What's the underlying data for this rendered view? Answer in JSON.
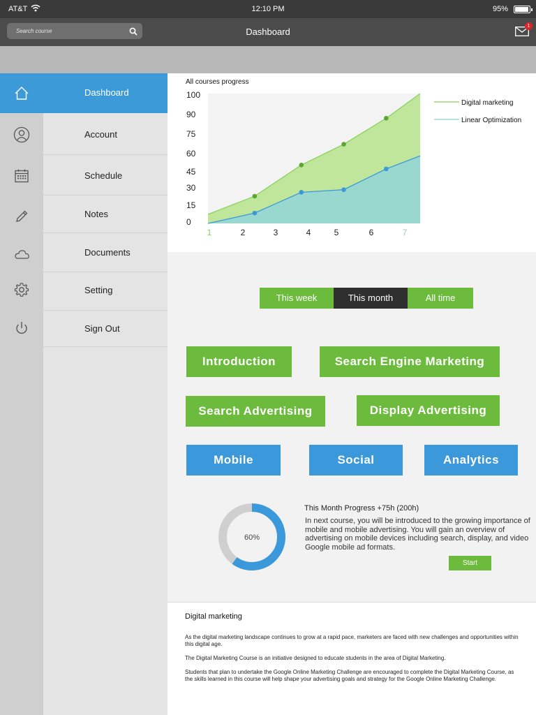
{
  "status": {
    "carrier": "AT&T",
    "time": "12:10 PM",
    "battery": "95%",
    "battery_level": 0.95
  },
  "search": {
    "placeholder": "Search course"
  },
  "header": {
    "title": "Dashboard",
    "mail_badge": "1"
  },
  "sidebar": {
    "items": [
      {
        "label": "Dashboard",
        "icon": "home-icon",
        "active": true
      },
      {
        "label": "Account",
        "icon": "user-icon"
      },
      {
        "label": "Schedule",
        "icon": "calendar-icon"
      },
      {
        "label": "Notes",
        "icon": "pencil-icon"
      },
      {
        "label": "Documents",
        "icon": "cloud-icon"
      },
      {
        "label": "Setting",
        "icon": "gear-icon"
      },
      {
        "label": "Sign Out",
        "icon": "power-icon"
      }
    ]
  },
  "chart_data": {
    "type": "area",
    "title": "All courses progress",
    "x": [
      1,
      2,
      3,
      4,
      5,
      6,
      7
    ],
    "x_ticks": [
      "1",
      "2",
      "3",
      "4",
      "5",
      "6",
      "7"
    ],
    "y_ticks": [
      "100",
      "90",
      "75",
      "60",
      "45",
      "30",
      "15",
      "0"
    ],
    "series": [
      {
        "name": "Digital marketing",
        "color": "#8bd160",
        "values": [
          7,
          21,
          45,
          61,
          81,
          100
        ]
      },
      {
        "name": "Linear Optimization",
        "color": "#3b98da",
        "values": [
          0,
          8,
          24,
          26,
          42,
          52
        ]
      }
    ],
    "legend_position": "right",
    "grid": false
  },
  "filters": {
    "week": "This week",
    "month": "This month",
    "all": "All time",
    "active": "month"
  },
  "courses": {
    "introduction": "Introduction",
    "sem": "Search Engine Marketing",
    "search_ads": "Search Advertising",
    "display_ads": "Display Advertising",
    "mobile": "Mobile",
    "social": "Social",
    "analytics": "Analytics"
  },
  "progress": {
    "percent_label": "60%",
    "percent_value": 60,
    "title": "This Month Progress +75h (200h)",
    "description": "In next course, you will be introduced to the growing importance of mobile and mobile advertising. You will gain an overview of advertising on mobile devices including search, display, and video Google mobile ad formats.",
    "start": "Start"
  },
  "info": {
    "title": "Digital marketing",
    "p1": "As the digital marketing landscape continues to grow at a rapid pace, marketers are faced with new challenges and opportunities within this digital age.",
    "p2": "The Digital Marketing Course is an initiative designed to educate students in the area of Digital Marketing.",
    "p3": "Students that plan to undertake the Google Online Marketing Challenge are encouraged to complete the Digital Marketing Course, as the skills learned in this course will help shape your advertising goals and strategy for the Google Online Marketing Challenge."
  }
}
